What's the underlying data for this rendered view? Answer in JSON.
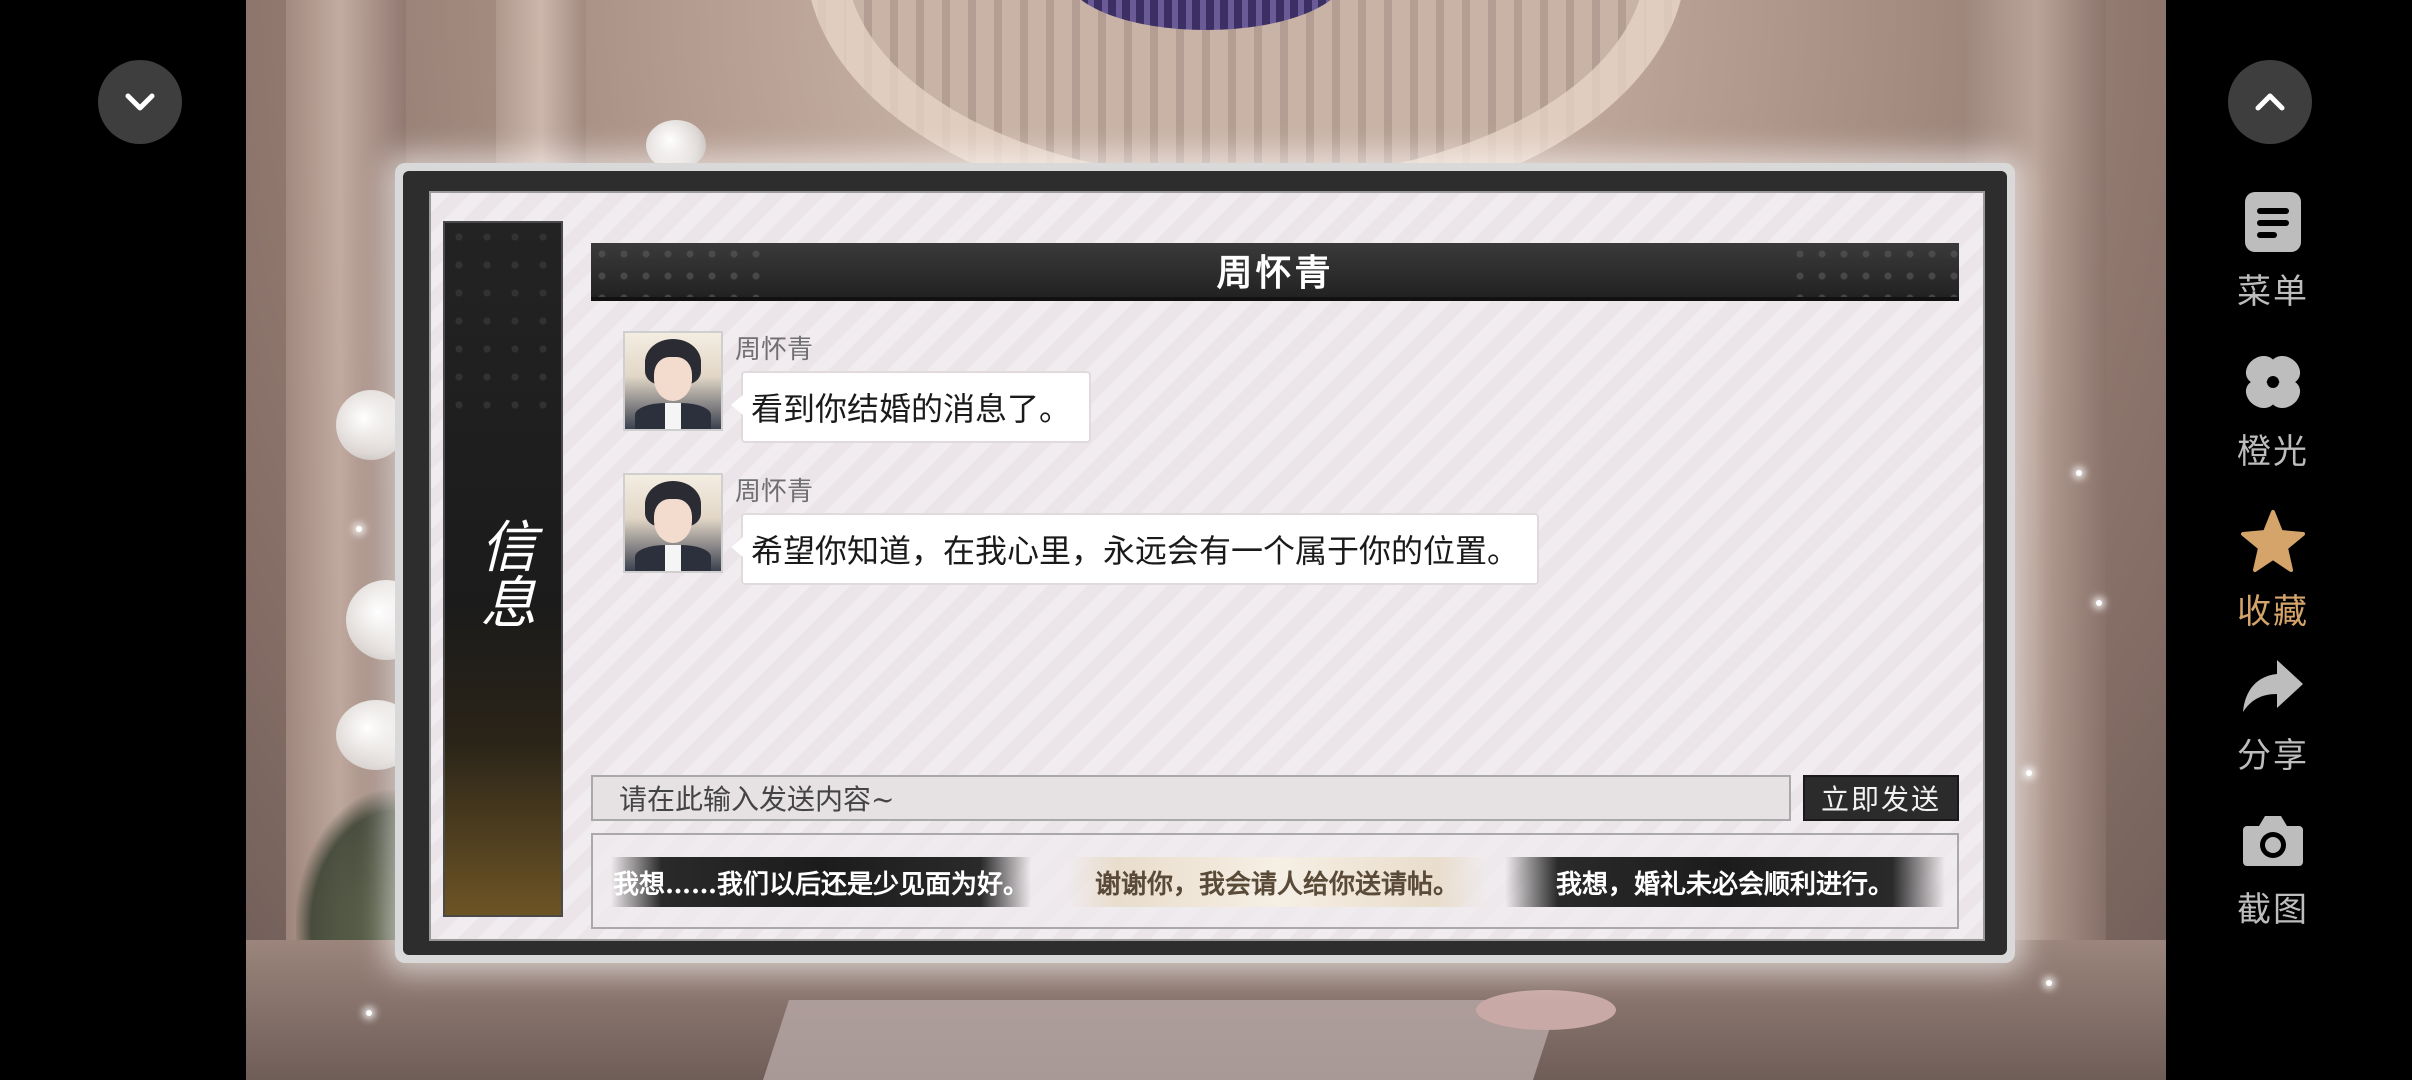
{
  "panel": {
    "side_label": "信息",
    "title": "周怀青"
  },
  "messages": [
    {
      "sender": "周怀青",
      "text": "看到你结婚的消息了。"
    },
    {
      "sender": "周怀青",
      "text": "希望你知道，在我心里，永远会有一个属于你的位置。"
    }
  ],
  "input": {
    "placeholder": "请在此输入发送内容~",
    "send_label": "立即发送"
  },
  "reply_options": [
    {
      "text": "我想……我们以后还是少见面为好。",
      "style": "dark"
    },
    {
      "text": "谢谢你，我会请人给你送请帖。",
      "style": "light"
    },
    {
      "text": "我想，婚礼未必会顺利进行。",
      "style": "dark"
    }
  ],
  "side_menu": [
    {
      "label": "菜单",
      "icon": "menu-icon",
      "active": false
    },
    {
      "label": "橙光",
      "icon": "orange-light-icon",
      "active": false
    },
    {
      "label": "收藏",
      "icon": "star-icon",
      "active": true
    },
    {
      "label": "分享",
      "icon": "share-icon",
      "active": false
    },
    {
      "label": "截图",
      "icon": "camera-icon",
      "active": false
    }
  ],
  "controls": {
    "left_button_icon": "chevron-down-icon",
    "right_button_icon": "chevron-up-icon"
  },
  "colors": {
    "active_accent": "#d4a46a",
    "inactive_label": "#bdbdbd",
    "panel_dark": "#2d2d2d"
  }
}
